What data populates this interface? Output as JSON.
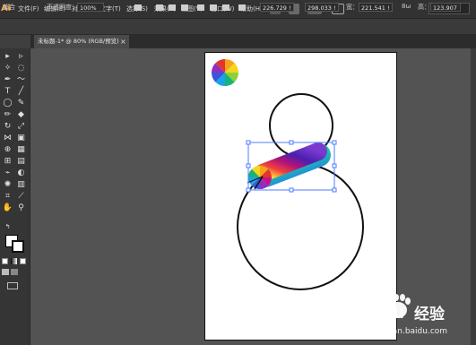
{
  "app": {
    "logo": "Ai"
  },
  "menu": [
    {
      "label": "文件(F)"
    },
    {
      "label": "编辑(E)"
    },
    {
      "label": "对象(O)"
    },
    {
      "label": "文字(T)"
    },
    {
      "label": "选择(S)"
    },
    {
      "label": "效果(C)"
    },
    {
      "label": "视图(V)"
    },
    {
      "label": "窗口(W)"
    },
    {
      "label": "帮助(H)"
    }
  ],
  "workspace": {
    "label": "基本功能"
  },
  "control_bar": {
    "selection_label": "编合",
    "opacity_label": "不透明度：",
    "opacity_value": "100%",
    "x_value": "226.729 !",
    "y_value": "298.033 !",
    "w_label": "宽：",
    "w_value": "221.541 !",
    "link_label": "8ω",
    "h_label": "高：",
    "h_value": "123.907"
  },
  "document": {
    "tab_label": "未标题-1* @ 80% (RGB/预览)",
    "close_glyph": "×"
  },
  "watermark": {
    "brand": "Baidu",
    "suffix": "经验",
    "url": "jingyan.baidu.com"
  },
  "colors": {
    "app_bg": "#3f3f3f",
    "canvas_bg": "#535353",
    "artboard": "#ffffff",
    "selection": "#4a7dff",
    "brand_orange": "#f2a33a"
  }
}
